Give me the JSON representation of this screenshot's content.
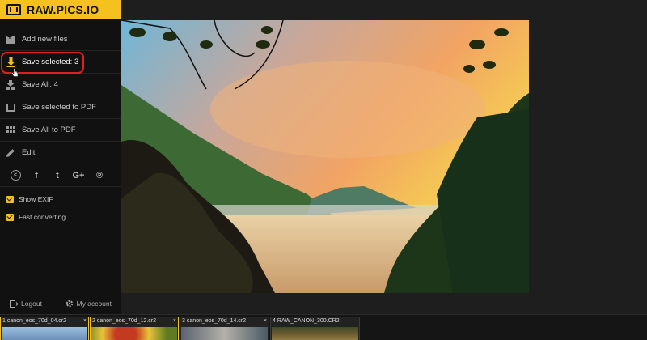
{
  "app": {
    "logo_text": "RAW.PICS.IO"
  },
  "sidebar": {
    "items": [
      {
        "label": "Add new files",
        "icon": "add-files-icon"
      },
      {
        "label": "Save selected: 3",
        "icon": "download-icon",
        "highlighted": true
      },
      {
        "label": "Save All: 4",
        "icon": "save-all-icon"
      },
      {
        "label": "Save selected to PDF",
        "icon": "pdf-icon"
      },
      {
        "label": "Save All to PDF",
        "icon": "pdf-grid-icon"
      },
      {
        "label": "Edit",
        "icon": "pencil-icon"
      }
    ],
    "social": [
      "share-icon",
      "facebook-icon",
      "tumblr-icon",
      "google-plus-icon",
      "pinterest-icon"
    ],
    "checkboxes": [
      {
        "label": "Show EXIF",
        "checked": true
      },
      {
        "label": "Fast converting",
        "checked": true
      }
    ],
    "footer": {
      "logout": "Logout",
      "account": "My account"
    }
  },
  "thumbnails": [
    {
      "index": "1",
      "name": "canon_eos_70d_04.cr2",
      "close": "×",
      "selected": true
    },
    {
      "index": "2",
      "name": "canon_eos_70d_12.cr2",
      "close": "×",
      "selected": true
    },
    {
      "index": "3",
      "name": "canon_eos_70d_14.cr2",
      "close": "×",
      "selected": true
    },
    {
      "index": "4",
      "name": "RAW_CANON_300.CR2",
      "close": "",
      "selected": false
    }
  ],
  "colors": {
    "accent": "#f5c11e",
    "highlight_ring": "#e0201e",
    "sidebar_bg": "#111111"
  }
}
